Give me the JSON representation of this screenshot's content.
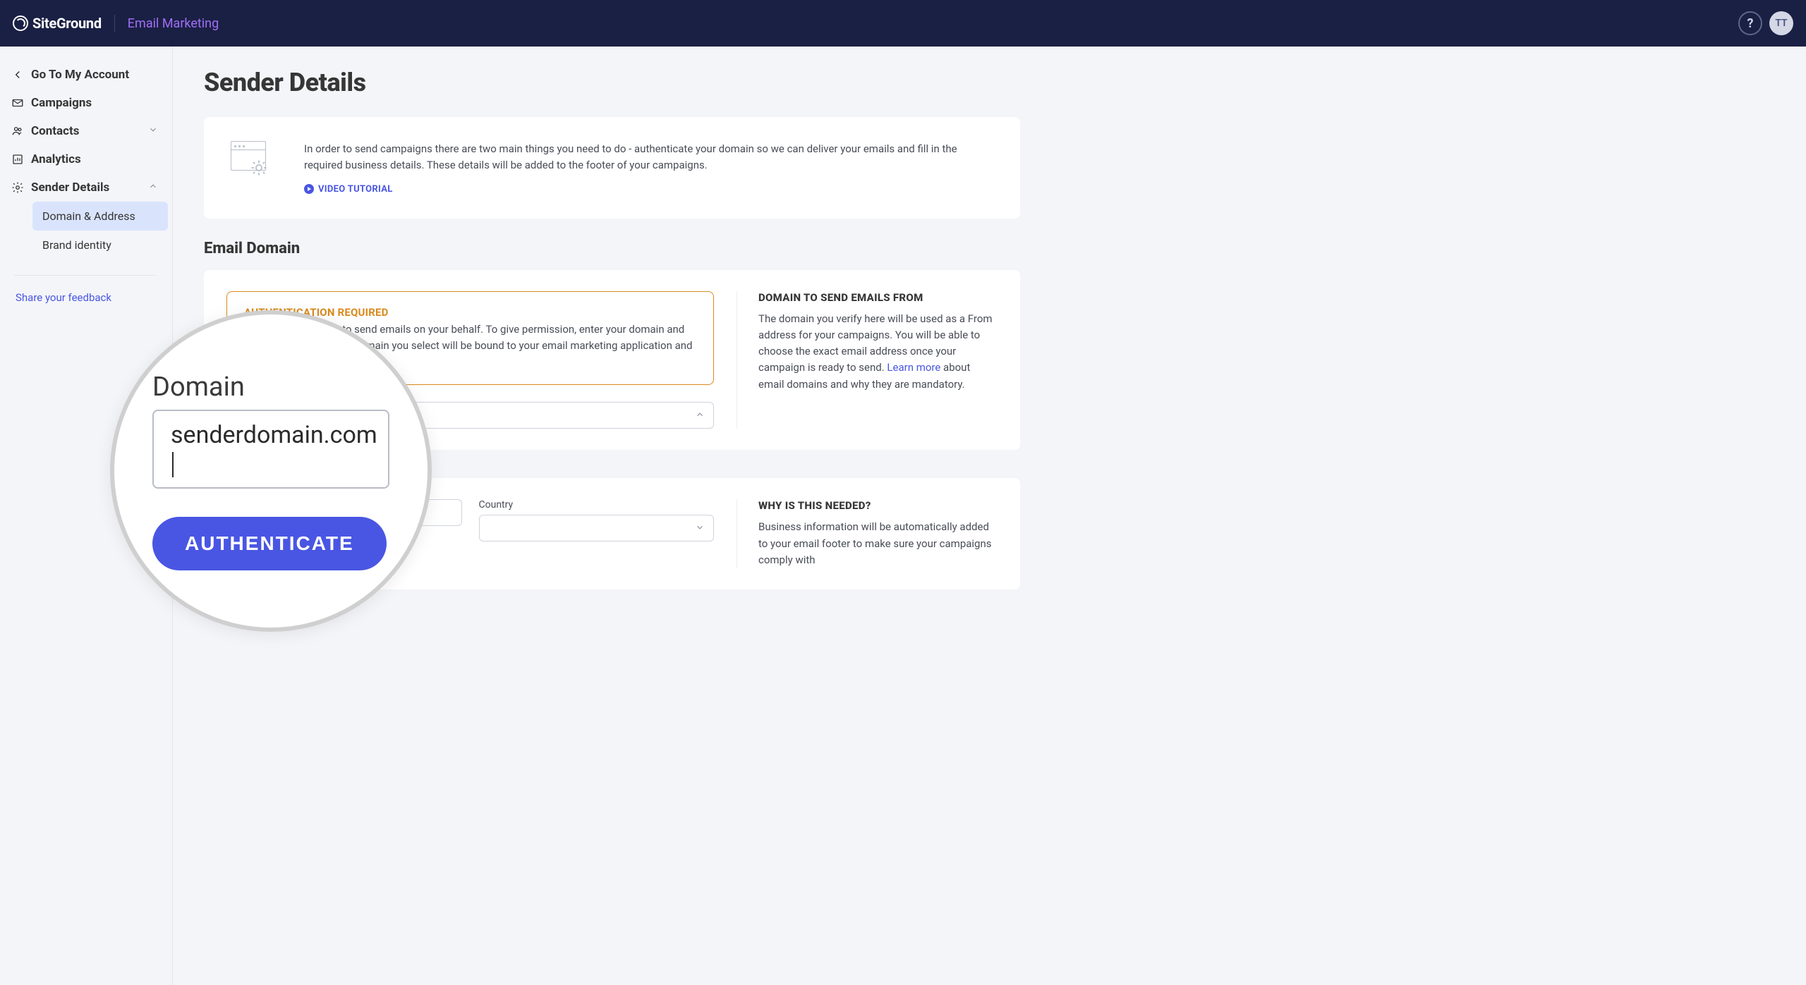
{
  "header": {
    "logo": "SiteGround",
    "product": "Email Marketing",
    "avatar": "TT"
  },
  "sidebar": {
    "back": "Go To My Account",
    "items": [
      {
        "label": "Campaigns",
        "icon": "mail-icon"
      },
      {
        "label": "Contacts",
        "icon": "contacts-icon",
        "expandable": true
      },
      {
        "label": "Analytics",
        "icon": "analytics-icon"
      },
      {
        "label": "Sender Details",
        "icon": "gear-icon",
        "expanded": true
      }
    ],
    "sender_sub": [
      {
        "label": "Domain & Address",
        "active": true
      },
      {
        "label": "Brand identity"
      }
    ],
    "feedback": "Share your feedback"
  },
  "page": {
    "title": "Sender Details",
    "intro": "In order to send campaigns there are two main things you need to do - authenticate your domain so we can deliver your emails and fill in the required business details. These details will be added to the footer of your campaigns.",
    "video_link": "VIDEO TUTORIAL",
    "section1_title": "Email Domain",
    "alert_title": "AUTHENTICATION REQUIRED",
    "alert_body_1": "We need permission to send emails on your behalf. To give permission, enter your domain and click Authenticate. The domain you select will be bound to your email marketing application and cannot be changed.",
    "side1_title": "DOMAIN TO SEND EMAILS FROM",
    "side1_body_pre": "The domain you verify here will be used as a From address for your campaigns. You will be able to choose the exact email address once your campaign is ready to send. ",
    "side1_learn": "Learn more",
    "side1_body_post": " about email domains and why they are mandatory.",
    "country_label": "Country",
    "side2_title": "WHY IS THIS NEEDED?",
    "side2_body": "Business information will be automatically added to your email footer to make sure your campaigns comply with"
  },
  "magnifier": {
    "label": "Domain",
    "value": "senderdomain.com",
    "button": "AUTHENTICATE"
  }
}
